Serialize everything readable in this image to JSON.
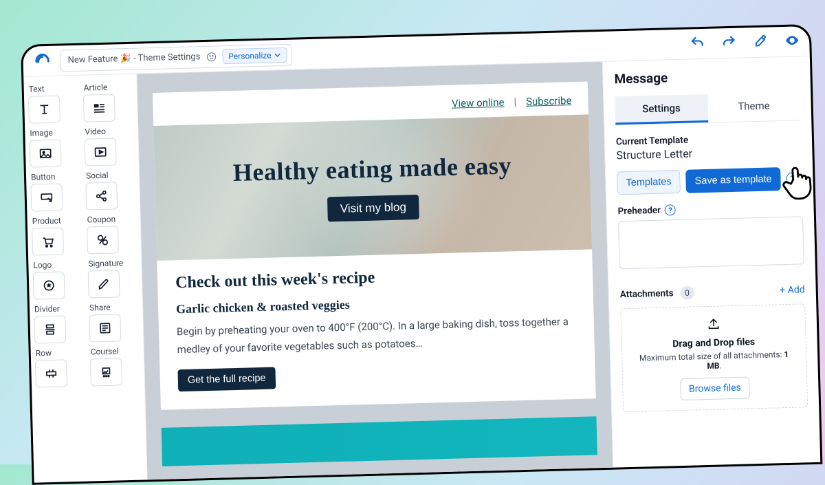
{
  "topbar": {
    "subject_text": "New Feature 🎉 - Theme Settings",
    "personalize_label": "Personalize"
  },
  "palette": [
    {
      "label": "Text",
      "name": "text-block"
    },
    {
      "label": "Article",
      "name": "article-block"
    },
    {
      "label": "Image",
      "name": "image-block"
    },
    {
      "label": "Video",
      "name": "video-block"
    },
    {
      "label": "Button",
      "name": "button-block"
    },
    {
      "label": "Social",
      "name": "social-block"
    },
    {
      "label": "Product",
      "name": "product-block"
    },
    {
      "label": "Coupon",
      "name": "coupon-block"
    },
    {
      "label": "Logo",
      "name": "logo-block"
    },
    {
      "label": "Signature",
      "name": "signature-block"
    },
    {
      "label": "Divider",
      "name": "divider-block"
    },
    {
      "label": "Share",
      "name": "share-block"
    },
    {
      "label": "Row",
      "name": "row-block"
    },
    {
      "label": "Coursel",
      "name": "carousel-block"
    }
  ],
  "email": {
    "view_online": "View online",
    "subscribe": "Subscribe",
    "hero_title": "Healthy eating made easy",
    "hero_cta": "Visit my blog",
    "section_heading": "Check out this week's recipe",
    "recipe_title": "Garlic chicken & roasted veggies",
    "recipe_body": "Begin by preheating your oven to 400°F (200°C). In a large baking dish, toss together a medley of your favorite vegetables such as potatoes…",
    "recipe_cta": "Get the full recipe"
  },
  "sidepanel": {
    "title": "Message",
    "tab_settings": "Settings",
    "tab_theme": "Theme",
    "current_template_label": "Current Template",
    "current_template_value": "Structure Letter",
    "templates_btn": "Templates",
    "save_template_btn": "Save as template",
    "preheader_label": "Preheader",
    "attachments_label": "Attachments",
    "attachments_count": "0",
    "add_link": "+ Add",
    "drop_title": "Drag and Drop files",
    "drop_sub_prefix": "Maximum total size of all attachments: ",
    "drop_sub_bold": "1 MB",
    "browse_btn": "Browse files"
  }
}
